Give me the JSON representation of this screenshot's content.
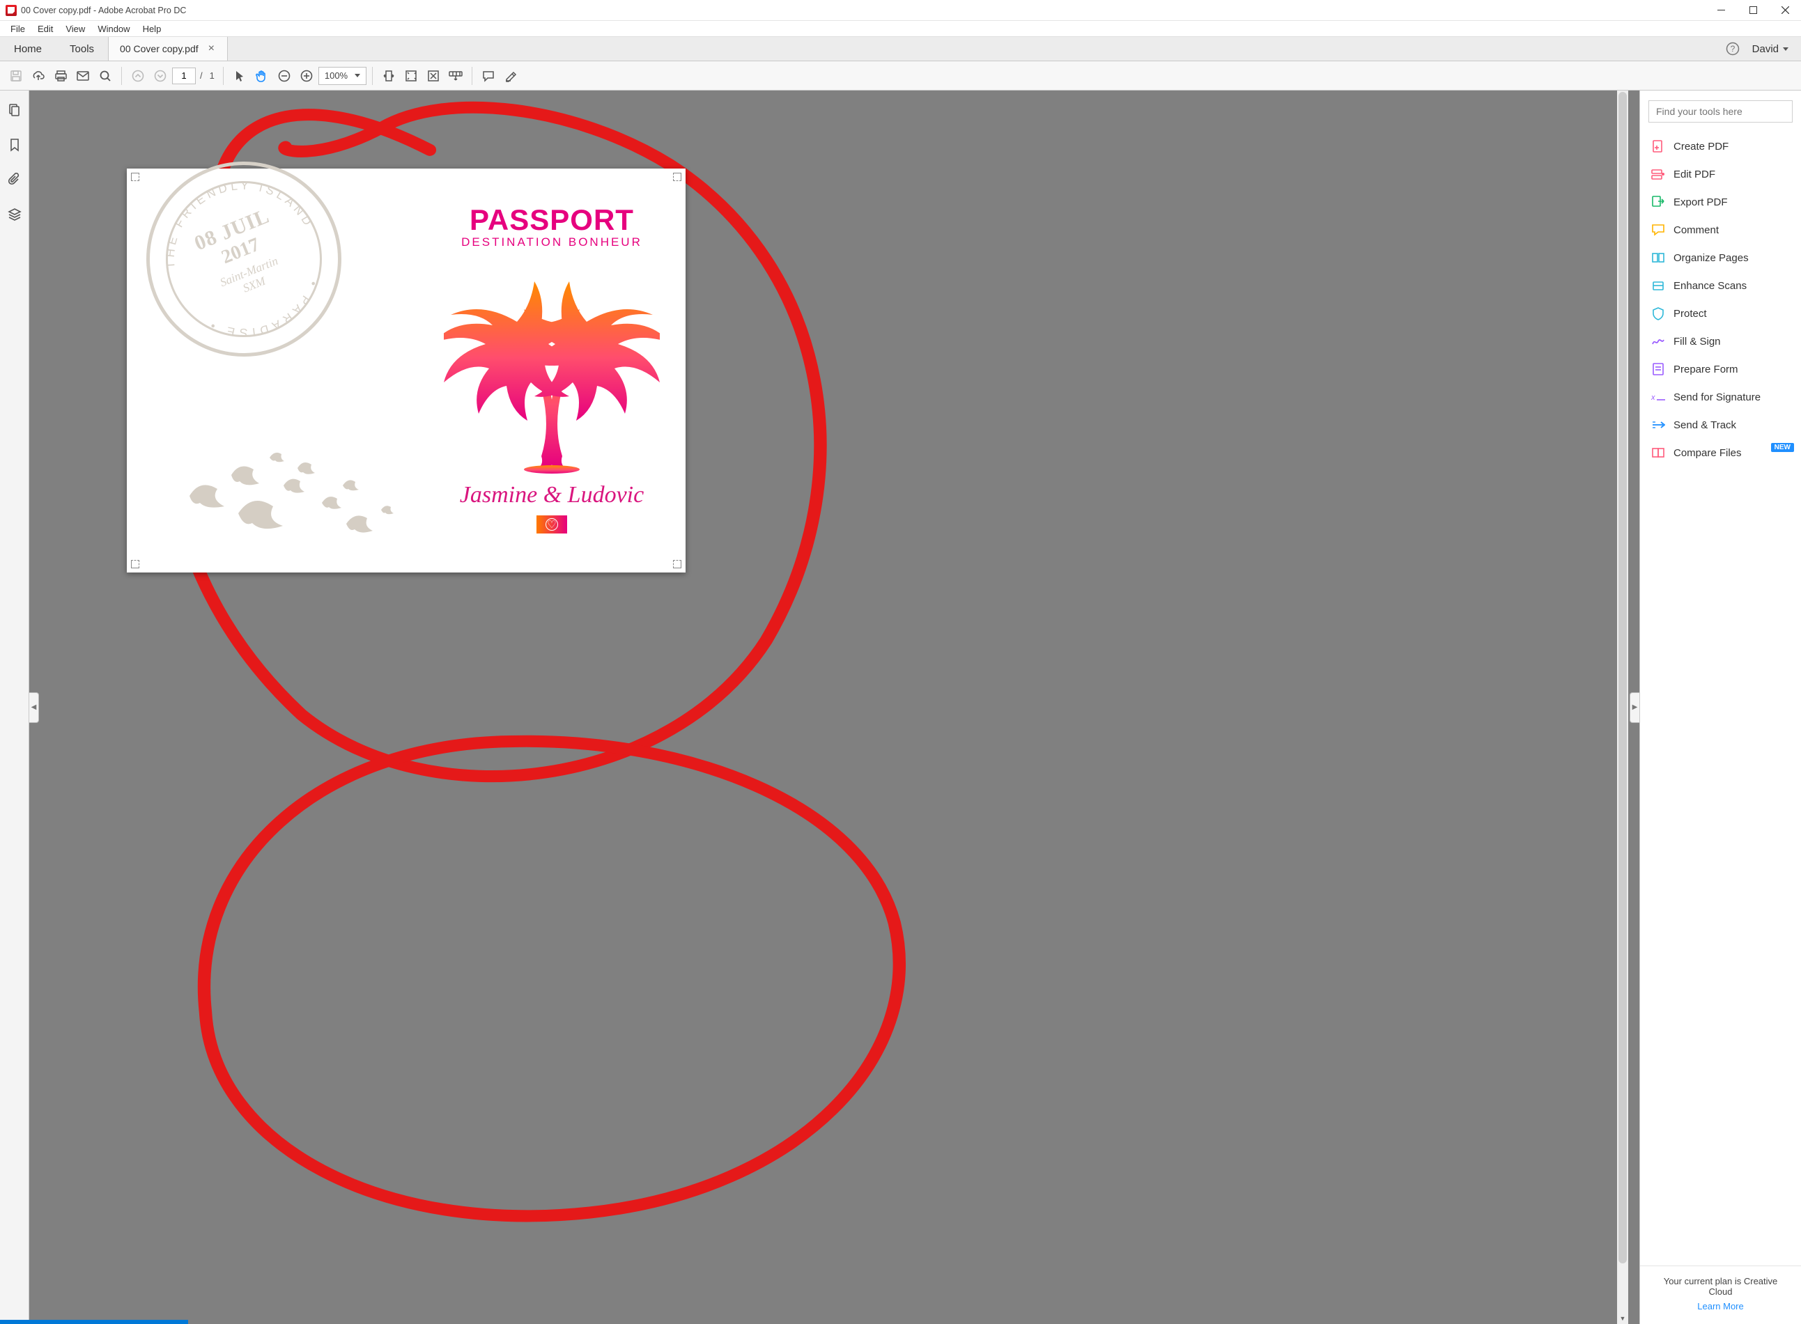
{
  "window": {
    "title": "00 Cover copy.pdf - Adobe Acrobat Pro DC"
  },
  "menu": {
    "file": "File",
    "edit": "Edit",
    "view": "View",
    "window": "Window",
    "help": "Help"
  },
  "tabs": {
    "home": "Home",
    "tools": "Tools",
    "doc": "00 Cover copy.pdf",
    "user": "David"
  },
  "toolbar": {
    "page_current": "1",
    "page_sep": "/",
    "page_total": "1",
    "zoom": "100%"
  },
  "document": {
    "passport": "PASSPORT",
    "subtitle": "DESTINATION BONHEUR",
    "names": "Jasmine & Ludovic",
    "stamp": {
      "date": "08 JUIL",
      "year": "2017",
      "location": "Saint-Martin",
      "code": "SXM",
      "arc_top": "THE FRIENDLY ISLAND",
      "arc_bottom": "• PARADISE •"
    }
  },
  "rightpanel": {
    "search_placeholder": "Find your tools here",
    "items": [
      {
        "label": "Create PDF"
      },
      {
        "label": "Edit PDF"
      },
      {
        "label": "Export PDF"
      },
      {
        "label": "Comment"
      },
      {
        "label": "Organize Pages"
      },
      {
        "label": "Enhance Scans"
      },
      {
        "label": "Protect"
      },
      {
        "label": "Fill & Sign"
      },
      {
        "label": "Prepare Form"
      },
      {
        "label": "Send for Signature"
      },
      {
        "label": "Send & Track"
      },
      {
        "label": "Compare Files"
      }
    ],
    "new_badge": "NEW",
    "footer_line": "Your current plan is Creative Cloud",
    "footer_link": "Learn More"
  }
}
